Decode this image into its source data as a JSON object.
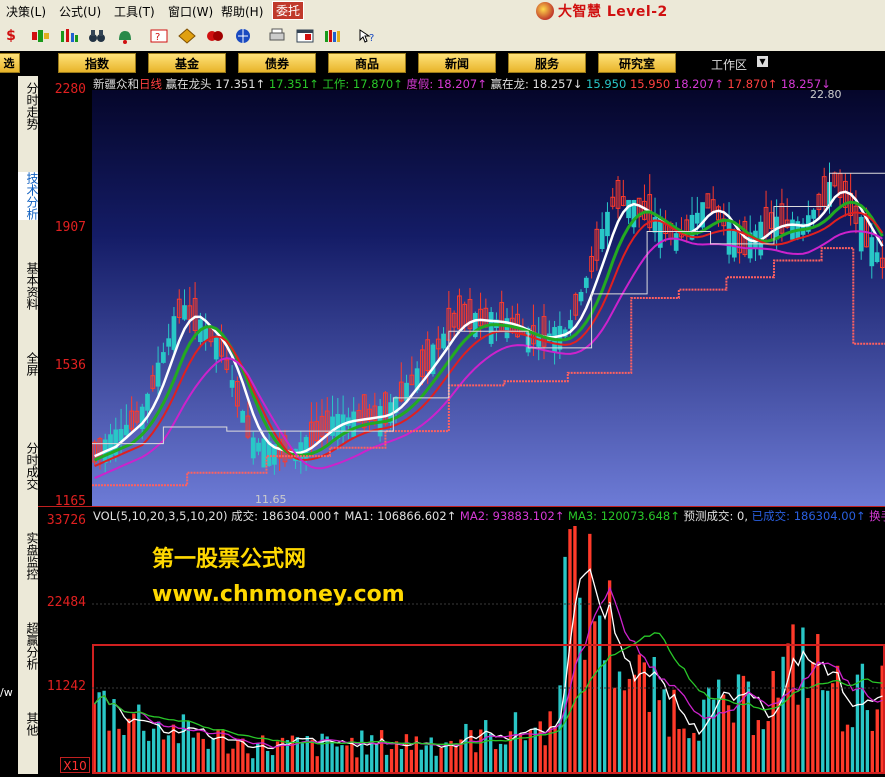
{
  "menu": {
    "items": [
      "决策(L)",
      "公式(U)",
      "工具(T)",
      "窗口(W)",
      "帮助(H)"
    ],
    "commission": "委托"
  },
  "brand": {
    "title": "大智慧 Level-2"
  },
  "toolbar": {
    "icons": [
      "stock-icon",
      "color-bars-icon",
      "bars-chart-icon",
      "binoculars-icon",
      "bell-icon",
      "help-book-icon",
      "diamond-icon",
      "link-icon",
      "globe-icon",
      "print-icon",
      "window-icon",
      "library-icon",
      "whats-this-icon"
    ]
  },
  "nav": {
    "buttons": [
      "指数",
      "基金",
      "债券",
      "商品",
      "新闻",
      "服务",
      "研究室"
    ],
    "stub": "选股",
    "workspace": "工作区"
  },
  "side_tabs": [
    "分时走势",
    "技术分析",
    "基本资料",
    "全屏",
    "分时成交",
    "实盘监控",
    "超赢分析",
    "其他"
  ],
  "left_stub": "/w",
  "price_legend": {
    "name": "新疆众和",
    "period": "日线",
    "items": [
      {
        "text": "赢在龙头 17.351↑",
        "color": "#e0e0e0"
      },
      {
        "text": "17.351↑",
        "color": "#29c729"
      },
      {
        "text": "工作: 17.870↑",
        "color": "#29c729"
      },
      {
        "text": "度假: 18.207↑",
        "color": "#d63ad6"
      },
      {
        "text": "赢在龙: 18.257↓",
        "color": "#e0e0e0"
      },
      {
        "text": "15.950",
        "color": "#29c7c7"
      },
      {
        "text": "15.950",
        "color": "#ff4040"
      },
      {
        "text": "18.207↑",
        "color": "#d63ad6"
      },
      {
        "text": "17.870↑",
        "color": "#ff4040"
      },
      {
        "text": "18.257↓",
        "color": "#d63ad6"
      }
    ]
  },
  "vol_legend": {
    "items": [
      {
        "text": "VOL(5,10,20,3,5,10,20)",
        "color": "#e0e0e0"
      },
      {
        "text": "成交: 186304.000↑",
        "color": "#e0e0e0"
      },
      {
        "text": "MA1: 106866.602↑",
        "color": "#e0e0e0"
      },
      {
        "text": "MA2: 93883.102↑",
        "color": "#d63ad6"
      },
      {
        "text": "MA3: 120073.648↑",
        "color": "#29c729"
      },
      {
        "text": "预测成交: 0,",
        "color": "#e0e0e0"
      },
      {
        "text": "已成交: 186304.00↑",
        "color": "#2a5fe0"
      },
      {
        "text": "换手率",
        "color": "#d63ad6"
      }
    ]
  },
  "price_axis": {
    "labels": [
      "2280",
      "1907",
      "1536",
      "1165"
    ],
    "max": 2280,
    "min": 1165
  },
  "vol_axis": {
    "labels": [
      "33726",
      "22484",
      "11242"
    ],
    "max": 33726,
    "min": 0
  },
  "annotations": {
    "high": "22.80",
    "low": "11.65"
  },
  "watermark": {
    "name": "第一股票公式网",
    "url": "www.chnmoney.com"
  },
  "scale_badge": "X10",
  "chart_data": {
    "type": "candlestick",
    "title": "新疆众和 日线",
    "ylim": [
      1165,
      2280
    ],
    "y_ticks": [
      2280,
      1907,
      1536,
      1165
    ],
    "price_high": 22.8,
    "price_low": 11.65,
    "series": [
      {
        "name": "赢在龙头",
        "values": [
          17.351
        ]
      },
      {
        "name": "工作",
        "values": [
          17.87
        ]
      },
      {
        "name": "度假",
        "values": [
          18.207
        ]
      },
      {
        "name": "赢在龙",
        "values": [
          18.257
        ]
      }
    ],
    "volume": {
      "ylim": [
        0,
        33726
      ],
      "y_ticks": [
        33726,
        22484,
        11242
      ],
      "last": 186304.0,
      "MA1": 106866.602,
      "MA2": 93883.102,
      "MA3": 120073.648
    }
  },
  "colors": {
    "up": "#ff3a2a",
    "down": "#29c7c7",
    "accent_red": "#c02020",
    "nav_gold": "#e8b42a",
    "ma_white": "#ffffff",
    "ma_green": "#22aa22",
    "ma_red": "#e02020",
    "ma_magenta": "#cc22cc"
  }
}
